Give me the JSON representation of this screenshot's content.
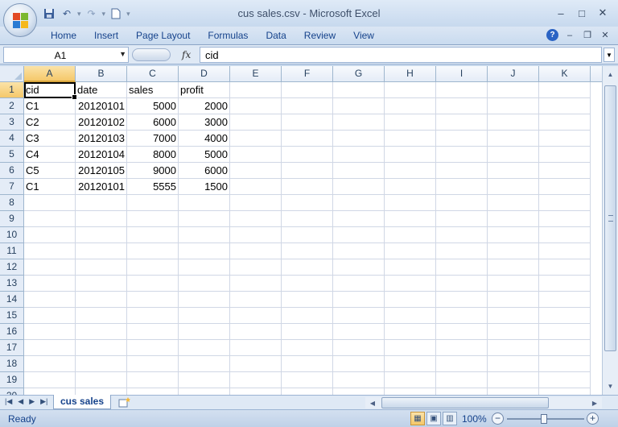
{
  "window": {
    "title": "cus sales.csv - Microsoft Excel",
    "controls": [
      "–",
      "□",
      "✕"
    ]
  },
  "qat": {
    "icons": [
      "save-icon",
      "undo-icon",
      "redo-icon",
      "new-document-icon",
      "customize-icon"
    ]
  },
  "ribbon": {
    "tabs": [
      "Home",
      "Insert",
      "Page Layout",
      "Formulas",
      "Data",
      "Review",
      "View"
    ]
  },
  "formula_bar": {
    "name_box": "A1",
    "fx": "fx",
    "formula": "cid"
  },
  "grid": {
    "columns": [
      "A",
      "B",
      "C",
      "D",
      "E",
      "F",
      "G",
      "H",
      "I",
      "J",
      "K"
    ],
    "rows": [
      "1",
      "2",
      "3",
      "4",
      "5",
      "6",
      "7",
      "8",
      "9",
      "10",
      "11",
      "12",
      "13",
      "14",
      "15",
      "16",
      "17",
      "18",
      "19",
      "20"
    ],
    "active_cell": "A1",
    "data": [
      [
        "cid",
        "date",
        "sales",
        "profit"
      ],
      [
        "C1",
        "20120101",
        "5000",
        "2000"
      ],
      [
        "C2",
        "20120102",
        "6000",
        "3000"
      ],
      [
        "C3",
        "20120103",
        "7000",
        "4000"
      ],
      [
        "C4",
        "20120104",
        "8000",
        "5000"
      ],
      [
        "C5",
        "20120105",
        "9000",
        "6000"
      ],
      [
        "C1",
        "20120101",
        "5555",
        "1500"
      ]
    ]
  },
  "sheets": {
    "tabs": [
      "cus sales"
    ],
    "active": "cus sales"
  },
  "status": {
    "text": "Ready",
    "zoom": "100%",
    "zoom_minus": "−",
    "zoom_plus": "+"
  }
}
